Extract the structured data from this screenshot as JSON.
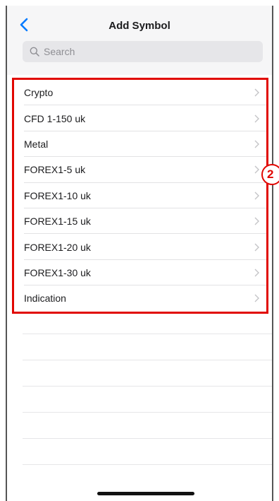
{
  "header": {
    "title": "Add Symbol",
    "back_icon": "chevron-left-icon"
  },
  "search": {
    "placeholder": "Search",
    "value": "",
    "icon": "search-icon"
  },
  "categories": [
    {
      "label": "Crypto"
    },
    {
      "label": "CFD 1-150 uk"
    },
    {
      "label": "Metal"
    },
    {
      "label": "FOREX1-5 uk"
    },
    {
      "label": "FOREX1-10 uk"
    },
    {
      "label": "FOREX1-15 uk"
    },
    {
      "label": "FOREX1-20 uk"
    },
    {
      "label": "FOREX1-30 uk"
    },
    {
      "label": "Indication"
    }
  ],
  "annotation": {
    "badge_label": "2",
    "color": "#e10600"
  },
  "colors": {
    "accent": "#007aff",
    "header_bg": "#f6f6f7",
    "search_bg": "#e6e6e9"
  }
}
